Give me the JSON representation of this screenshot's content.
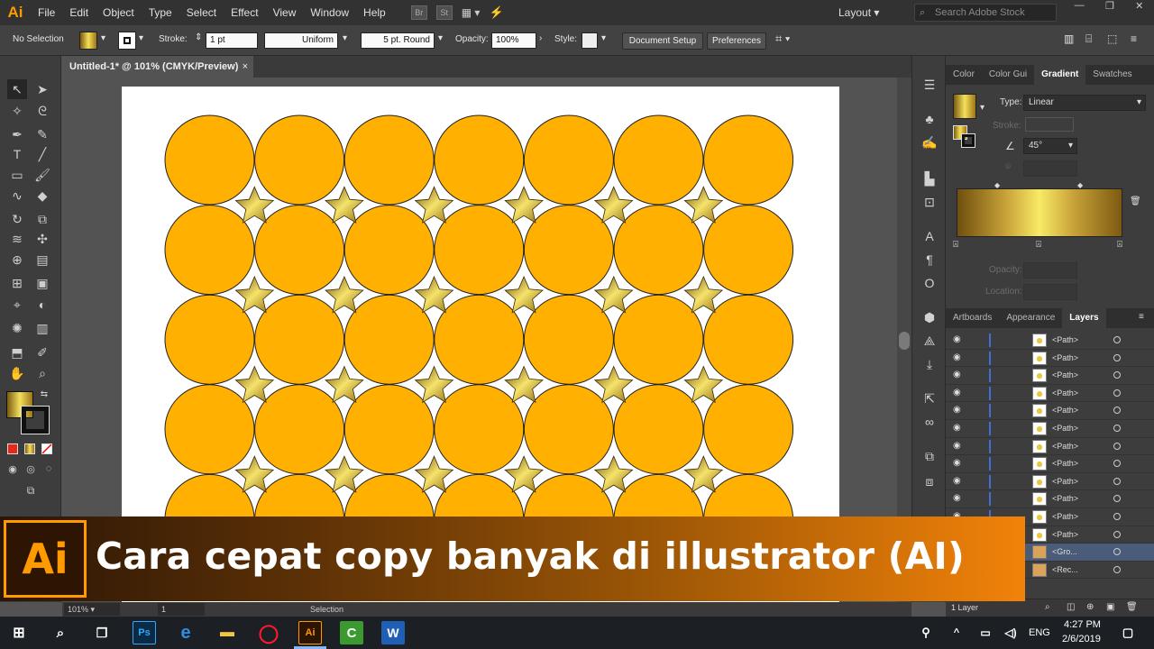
{
  "app": {
    "logo": "Ai"
  },
  "menu": [
    "File",
    "Edit",
    "Object",
    "Type",
    "Select",
    "Effect",
    "View",
    "Window",
    "Help"
  ],
  "menu_icons": {
    "bridge": "Br",
    "stock": "St"
  },
  "workspace": "Layout",
  "search": {
    "placeholder": "Search Adobe Stock"
  },
  "control": {
    "selection": "No Selection",
    "stroke_label": "Stroke:",
    "stroke_value": "1 pt",
    "profile": "Uniform",
    "brush": "5 pt. Round",
    "opacity_label": "Opacity:",
    "opacity_value": "100%",
    "style_label": "Style:",
    "doc_setup": "Document Setup",
    "preferences": "Preferences"
  },
  "document": {
    "tab_title": "Untitled-1* @ 101% (CMYK/Preview)",
    "close": "×"
  },
  "status": {
    "zoom": "101%",
    "artboard": "1",
    "tool": "Selection"
  },
  "panels": {
    "top_tabs": [
      "Color",
      "Color Gui",
      "Gradient",
      "Swatches"
    ],
    "active_top": "Gradient",
    "gradient": {
      "type_label": "Type:",
      "type_value": "Linear",
      "stroke_label": "Stroke:",
      "angle_value": "45°",
      "opacity_label": "Opacity:",
      "location_label": "Location:"
    },
    "bottom_tabs": [
      "Artboards",
      "Appearance",
      "Layers"
    ],
    "active_bottom": "Layers",
    "layers": [
      "<Path>",
      "<Path>",
      "<Path>",
      "<Path>",
      "<Path>",
      "<Path>",
      "<Path>",
      "<Path>",
      "<Path>",
      "<Path>",
      "<Path>",
      "<Path>",
      "<Gro...",
      "<Rec..."
    ],
    "layer_count": "1 Layer"
  },
  "banner": {
    "logo": "Ai",
    "title": "Cara cepat copy banyak di illustrator (AI)"
  },
  "taskbar": {
    "apps": [
      "Ps",
      "e",
      "folder",
      "opera",
      "Ai",
      "camtasia",
      "W"
    ],
    "lang": "ENG",
    "time": "4:27 PM",
    "date": "2/6/2019"
  },
  "colors": {
    "circle_fill": "#ffb000",
    "accent_ai": "#ff9a00",
    "gold_dark": "#7c5a12",
    "gold_light": "#f4e05a"
  }
}
